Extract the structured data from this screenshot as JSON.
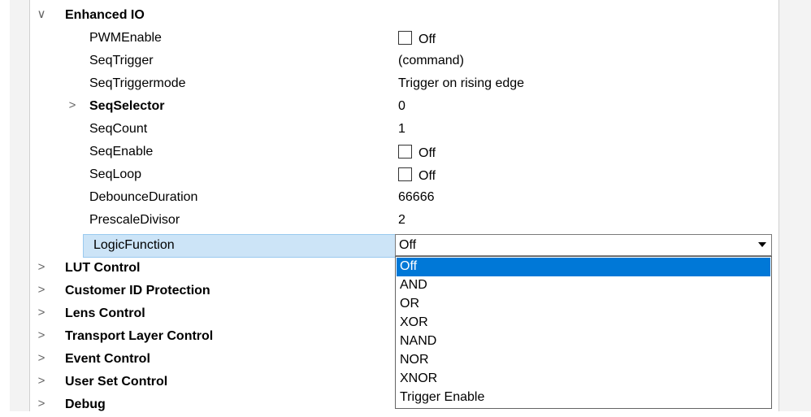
{
  "tree": {
    "enhanced_io": {
      "label": "Enhanced IO",
      "expander": "∨"
    },
    "props": [
      {
        "name": "PWMEnable",
        "value": "Off",
        "checkbox": true
      },
      {
        "name": "SeqTrigger",
        "value": "(command)"
      },
      {
        "name": "SeqTriggermode",
        "value": "Trigger on rising edge"
      },
      {
        "name": "SeqSelector",
        "value": "0",
        "bold": true,
        "expander": ">"
      },
      {
        "name": "SeqCount",
        "value": "1"
      },
      {
        "name": "SeqEnable",
        "value": "Off",
        "checkbox": true
      },
      {
        "name": "SeqLoop",
        "value": "Off",
        "checkbox": true
      },
      {
        "name": "DebounceDuration",
        "value": "66666"
      },
      {
        "name": "PrescaleDivisor",
        "value": "2"
      }
    ],
    "selected": {
      "name": "LogicFunction",
      "value": "Off"
    },
    "categories": [
      {
        "label": "LUT Control",
        "expander": ">"
      },
      {
        "label": "Customer ID Protection",
        "expander": ">"
      },
      {
        "label": "Lens Control",
        "expander": ">"
      },
      {
        "label": "Transport Layer Control",
        "expander": ">"
      },
      {
        "label": "Event Control",
        "expander": ">"
      },
      {
        "label": "User Set Control",
        "expander": ">"
      },
      {
        "label": "Debug",
        "expander": ">"
      }
    ]
  },
  "dropdown": {
    "options": [
      "Off",
      "AND",
      "OR",
      "XOR",
      "NAND",
      "NOR",
      "XNOR",
      "Trigger Enable"
    ],
    "highlighted_index": 0
  },
  "colors": {
    "selection": "#cce4f7",
    "highlight": "#0078d7"
  }
}
